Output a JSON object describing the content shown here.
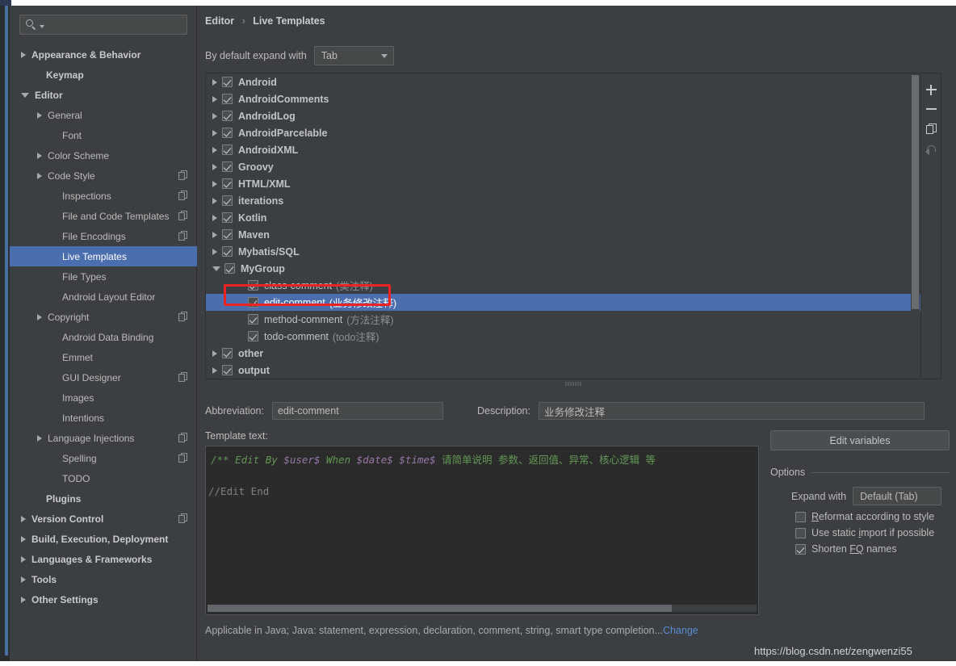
{
  "window": {
    "watermark": "https://blog.csdn.net/zengwenzi55"
  },
  "sidebar": {
    "search": {
      "value": "",
      "placeholder": ""
    },
    "items": [
      {
        "label": "Appearance & Behavior",
        "arrow": "right",
        "bold": true,
        "indent": 14,
        "copy": false,
        "selected": false
      },
      {
        "label": "Keymap",
        "arrow": "none",
        "bold": true,
        "indent": 32,
        "copy": false,
        "selected": false
      },
      {
        "label": "Editor",
        "arrow": "down",
        "bold": true,
        "indent": 14,
        "copy": false,
        "selected": false
      },
      {
        "label": "General",
        "arrow": "right",
        "bold": false,
        "indent": 34,
        "copy": false,
        "selected": false
      },
      {
        "label": "Font",
        "arrow": "none",
        "bold": false,
        "indent": 52,
        "copy": false,
        "selected": false
      },
      {
        "label": "Color Scheme",
        "arrow": "right",
        "bold": false,
        "indent": 34,
        "copy": false,
        "selected": false
      },
      {
        "label": "Code Style",
        "arrow": "right",
        "bold": false,
        "indent": 34,
        "copy": true,
        "selected": false
      },
      {
        "label": "Inspections",
        "arrow": "none",
        "bold": false,
        "indent": 52,
        "copy": true,
        "selected": false
      },
      {
        "label": "File and Code Templates",
        "arrow": "none",
        "bold": false,
        "indent": 52,
        "copy": true,
        "selected": false
      },
      {
        "label": "File Encodings",
        "arrow": "none",
        "bold": false,
        "indent": 52,
        "copy": true,
        "selected": false
      },
      {
        "label": "Live Templates",
        "arrow": "none",
        "bold": false,
        "indent": 52,
        "copy": false,
        "selected": true
      },
      {
        "label": "File Types",
        "arrow": "none",
        "bold": false,
        "indent": 52,
        "copy": false,
        "selected": false
      },
      {
        "label": "Android Layout Editor",
        "arrow": "none",
        "bold": false,
        "indent": 52,
        "copy": false,
        "selected": false
      },
      {
        "label": "Copyright",
        "arrow": "right",
        "bold": false,
        "indent": 34,
        "copy": true,
        "selected": false
      },
      {
        "label": "Android Data Binding",
        "arrow": "none",
        "bold": false,
        "indent": 52,
        "copy": false,
        "selected": false
      },
      {
        "label": "Emmet",
        "arrow": "none",
        "bold": false,
        "indent": 52,
        "copy": false,
        "selected": false
      },
      {
        "label": "GUI Designer",
        "arrow": "none",
        "bold": false,
        "indent": 52,
        "copy": true,
        "selected": false
      },
      {
        "label": "Images",
        "arrow": "none",
        "bold": false,
        "indent": 52,
        "copy": false,
        "selected": false
      },
      {
        "label": "Intentions",
        "arrow": "none",
        "bold": false,
        "indent": 52,
        "copy": false,
        "selected": false
      },
      {
        "label": "Language Injections",
        "arrow": "right",
        "bold": false,
        "indent": 34,
        "copy": true,
        "selected": false
      },
      {
        "label": "Spelling",
        "arrow": "none",
        "bold": false,
        "indent": 52,
        "copy": true,
        "selected": false
      },
      {
        "label": "TODO",
        "arrow": "none",
        "bold": false,
        "indent": 52,
        "copy": false,
        "selected": false
      },
      {
        "label": "Plugins",
        "arrow": "none",
        "bold": true,
        "indent": 32,
        "copy": false,
        "selected": false
      },
      {
        "label": "Version Control",
        "arrow": "right",
        "bold": true,
        "indent": 14,
        "copy": true,
        "selected": false
      },
      {
        "label": "Build, Execution, Deployment",
        "arrow": "right",
        "bold": true,
        "indent": 14,
        "copy": false,
        "selected": false
      },
      {
        "label": "Languages & Frameworks",
        "arrow": "right",
        "bold": true,
        "indent": 14,
        "copy": false,
        "selected": false
      },
      {
        "label": "Tools",
        "arrow": "right",
        "bold": true,
        "indent": 14,
        "copy": false,
        "selected": false
      },
      {
        "label": "Other Settings",
        "arrow": "right",
        "bold": true,
        "indent": 14,
        "copy": false,
        "selected": false
      }
    ]
  },
  "main": {
    "breadcrumb": {
      "root": "Editor",
      "separator": "›",
      "leaf": "Live Templates"
    },
    "expand_with": {
      "label": "By default expand with",
      "value": "Tab"
    },
    "toolbar": {
      "add": "add-button",
      "remove": "remove-button",
      "duplicate": "duplicate-button",
      "revert": "revert-button"
    },
    "templates": [
      {
        "label": "Android",
        "desc": "",
        "arrow": "right",
        "checked": true,
        "child": false,
        "selected": false
      },
      {
        "label": "AndroidComments",
        "desc": "",
        "arrow": "right",
        "checked": true,
        "child": false,
        "selected": false
      },
      {
        "label": "AndroidLog",
        "desc": "",
        "arrow": "right",
        "checked": true,
        "child": false,
        "selected": false
      },
      {
        "label": "AndroidParcelable",
        "desc": "",
        "arrow": "right",
        "checked": true,
        "child": false,
        "selected": false
      },
      {
        "label": "AndroidXML",
        "desc": "",
        "arrow": "right",
        "checked": true,
        "child": false,
        "selected": false
      },
      {
        "label": "Groovy",
        "desc": "",
        "arrow": "right",
        "checked": true,
        "child": false,
        "selected": false
      },
      {
        "label": "HTML/XML",
        "desc": "",
        "arrow": "right",
        "checked": true,
        "child": false,
        "selected": false
      },
      {
        "label": "iterations",
        "desc": "",
        "arrow": "right",
        "checked": true,
        "child": false,
        "selected": false
      },
      {
        "label": "Kotlin",
        "desc": "",
        "arrow": "right",
        "checked": true,
        "child": false,
        "selected": false
      },
      {
        "label": "Maven",
        "desc": "",
        "arrow": "right",
        "checked": true,
        "child": false,
        "selected": false
      },
      {
        "label": "Mybatis/SQL",
        "desc": "",
        "arrow": "right",
        "checked": true,
        "child": false,
        "selected": false
      },
      {
        "label": "MyGroup",
        "desc": "",
        "arrow": "down",
        "checked": true,
        "child": false,
        "selected": false
      },
      {
        "label": "class-comment",
        "desc": "(类注释)",
        "arrow": "none",
        "checked": true,
        "child": true,
        "selected": false
      },
      {
        "label": "edit-comment",
        "desc": "(业务修改注释)",
        "arrow": "none",
        "checked": true,
        "child": true,
        "selected": true
      },
      {
        "label": "method-comment",
        "desc": "(方法注释)",
        "arrow": "none",
        "checked": true,
        "child": true,
        "selected": false
      },
      {
        "label": "todo-comment",
        "desc": "(todo注释)",
        "arrow": "none",
        "checked": true,
        "child": true,
        "selected": false
      },
      {
        "label": "other",
        "desc": "",
        "arrow": "right",
        "checked": true,
        "child": false,
        "selected": false
      },
      {
        "label": "output",
        "desc": "",
        "arrow": "right",
        "checked": true,
        "child": false,
        "selected": false
      }
    ],
    "detail": {
      "abbreviation_label": "Abbreviation:",
      "abbreviation_value": "edit-comment",
      "description_label": "Description:",
      "description_value": "业务修改注释",
      "template_text_label": "Template text:",
      "code": {
        "line1_prefix": "/** Edit By ",
        "line1_var1": "$user$",
        "line1_mid": " When ",
        "line1_var2": "$date$",
        "line1_sp": " ",
        "line1_var3": "$time$",
        "line1_tail": "  请简单说明 参数、返回值、异常、核心逻辑 等",
        "line3": "//Edit End"
      },
      "applicable_text": "Applicable in Java; Java: statement, expression, declaration, comment, string, smart type completion...",
      "applicable_link": "Change"
    },
    "options": {
      "edit_variables_label": "Edit variables",
      "header": "Options",
      "expand_with_label": "Expand with",
      "expand_with_value": "Default (Tab)",
      "checkboxes": [
        {
          "label_pre": "",
          "label_key": "R",
          "label_post": "eformat according to style",
          "checked": false
        },
        {
          "label_pre": "Use static ",
          "label_key": "i",
          "label_post": "mport if possible",
          "checked": false
        },
        {
          "label_pre": "Shorten ",
          "label_key": "FQ",
          "label_post": " names",
          "checked": true
        }
      ]
    }
  },
  "colors": {
    "panel_bg": "#3c3f41",
    "selection_blue": "#4b6eaf",
    "code_bg": "#2b2b2b",
    "comment_green": "#629755",
    "variable_purple": "#9876aa",
    "link_blue": "#5a8cd6",
    "annotation_red": "#ee2222"
  }
}
